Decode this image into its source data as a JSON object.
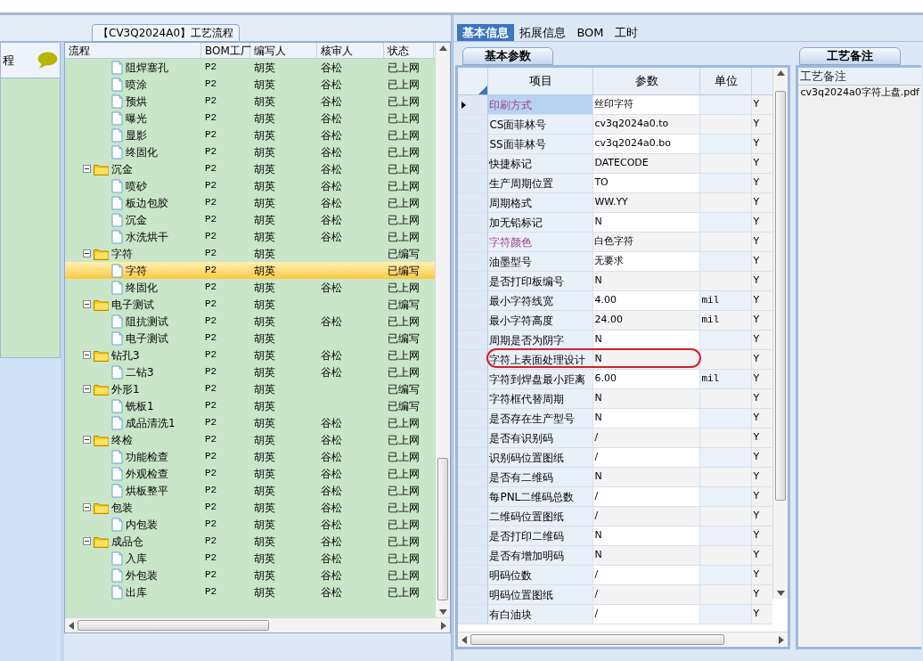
{
  "left_panel": {
    "label": "程"
  },
  "flow_group": {
    "title": "【CV3Q2024A0】工艺流程"
  },
  "tree_table": {
    "columns": [
      "流程",
      "BOM工厂",
      "编写人",
      "核审人",
      "状态"
    ],
    "nodes": [
      {
        "kind": "continued",
        "children": [
          {
            "kind": "step",
            "name": "阻焊塞孔",
            "bom": "P2",
            "writer": "胡英",
            "reviewer": "谷松",
            "status": "已上网",
            "selected": false
          },
          {
            "kind": "step",
            "name": "喷涂",
            "bom": "P2",
            "writer": "胡英",
            "reviewer": "谷松",
            "status": "已上网",
            "selected": false
          },
          {
            "kind": "step",
            "name": "预烘",
            "bom": "P2",
            "writer": "胡英",
            "reviewer": "谷松",
            "status": "已上网",
            "selected": false
          },
          {
            "kind": "step",
            "name": "曝光",
            "bom": "P2",
            "writer": "胡英",
            "reviewer": "谷松",
            "status": "已上网",
            "selected": false
          },
          {
            "kind": "step",
            "name": "显影",
            "bom": "P2",
            "writer": "胡英",
            "reviewer": "谷松",
            "status": "已上网",
            "selected": false
          },
          {
            "kind": "step",
            "name": "终固化",
            "bom": "P2",
            "writer": "胡英",
            "reviewer": "谷松",
            "status": "已上网",
            "selected": false
          }
        ]
      },
      {
        "kind": "folder",
        "name": "沉金",
        "bom": "P2",
        "writer": "胡英",
        "reviewer": "谷松",
        "status": "已上网",
        "selected": false,
        "expanded": true,
        "children": [
          {
            "kind": "step",
            "name": "喷砂",
            "bom": "P2",
            "writer": "胡英",
            "reviewer": "谷松",
            "status": "已上网",
            "selected": false
          },
          {
            "kind": "step",
            "name": "板边包胶",
            "bom": "P2",
            "writer": "胡英",
            "reviewer": "谷松",
            "status": "已上网",
            "selected": false
          },
          {
            "kind": "step",
            "name": "沉金",
            "bom": "P2",
            "writer": "胡英",
            "reviewer": "谷松",
            "status": "已上网",
            "selected": false
          },
          {
            "kind": "step",
            "name": "水洗烘干",
            "bom": "P2",
            "writer": "胡英",
            "reviewer": "谷松",
            "status": "已上网",
            "selected": false
          }
        ]
      },
      {
        "kind": "folder",
        "name": "字符",
        "bom": "P2",
        "writer": "胡英",
        "status": "已编写",
        "selected": false,
        "expanded": true,
        "children": [
          {
            "kind": "step",
            "name": "字符",
            "bom": "P2",
            "writer": "胡英",
            "status": "已编写",
            "selected": true
          },
          {
            "kind": "step",
            "name": "终固化",
            "bom": "P2",
            "writer": "胡英",
            "reviewer": "谷松",
            "status": "已上网",
            "selected": false
          }
        ]
      },
      {
        "kind": "folder",
        "name": "电子测试",
        "bom": "P2",
        "writer": "胡英",
        "status": "已编写",
        "selected": false,
        "expanded": true,
        "children": [
          {
            "kind": "step",
            "name": "阻抗测试",
            "bom": "P2",
            "writer": "胡英",
            "reviewer": "谷松",
            "status": "已上网",
            "selected": false
          },
          {
            "kind": "step",
            "name": "电子测试",
            "bom": "P2",
            "writer": "胡英",
            "status": "已编写",
            "selected": false
          }
        ]
      },
      {
        "kind": "folder",
        "name": "钻孔3",
        "bom": "P2",
        "writer": "胡英",
        "reviewer": "谷松",
        "status": "已上网",
        "selected": false,
        "expanded": true,
        "children": [
          {
            "kind": "step",
            "name": "二钻3",
            "bom": "P2",
            "writer": "胡英",
            "reviewer": "谷松",
            "status": "已上网",
            "selected": false
          }
        ]
      },
      {
        "kind": "folder",
        "name": "外形1",
        "bom": "P2",
        "writer": "胡英",
        "status": "已编写",
        "selected": false,
        "expanded": true,
        "children": [
          {
            "kind": "step",
            "name": "铣板1",
            "bom": "P2",
            "writer": "胡英",
            "status": "已编写",
            "selected": false
          },
          {
            "kind": "step",
            "name": "成品清洗1",
            "bom": "P2",
            "writer": "胡英",
            "reviewer": "谷松",
            "status": "已上网",
            "selected": false
          }
        ]
      },
      {
        "kind": "folder",
        "name": "终检",
        "bom": "P2",
        "writer": "胡英",
        "reviewer": "谷松",
        "status": "已上网",
        "selected": false,
        "expanded": true,
        "children": [
          {
            "kind": "step",
            "name": "功能检查",
            "bom": "P2",
            "writer": "胡英",
            "reviewer": "谷松",
            "status": "已上网",
            "selected": false
          },
          {
            "kind": "step",
            "name": "外观检查",
            "bom": "P2",
            "writer": "胡英",
            "reviewer": "谷松",
            "status": "已上网",
            "selected": false
          },
          {
            "kind": "step",
            "name": "烘板整平",
            "bom": "P2",
            "writer": "胡英",
            "reviewer": "谷松",
            "status": "已上网",
            "selected": false
          }
        ]
      },
      {
        "kind": "folder",
        "name": "包装",
        "bom": "P2",
        "writer": "胡英",
        "reviewer": "谷松",
        "status": "已上网",
        "selected": false,
        "expanded": true,
        "children": [
          {
            "kind": "step",
            "name": "内包装",
            "bom": "P2",
            "writer": "胡英",
            "reviewer": "谷松",
            "status": "已上网",
            "selected": false
          }
        ]
      },
      {
        "kind": "folder",
        "name": "成品仓",
        "bom": "P2",
        "writer": "胡英",
        "reviewer": "谷松",
        "status": "已上网",
        "selected": false,
        "expanded": true,
        "children": [
          {
            "kind": "step",
            "name": "入库",
            "bom": "P2",
            "writer": "胡英",
            "reviewer": "谷松",
            "status": "已上网",
            "selected": false
          },
          {
            "kind": "step",
            "name": "外包装",
            "bom": "P2",
            "writer": "胡英",
            "reviewer": "谷松",
            "status": "已上网",
            "selected": false
          },
          {
            "kind": "step",
            "name": "出库",
            "bom": "P2",
            "writer": "胡英",
            "reviewer": "谷松",
            "status": "已上网",
            "selected": false
          }
        ]
      }
    ]
  },
  "tabs": [
    {
      "label": "基本信息",
      "selected": true
    },
    {
      "label": "拓展信息",
      "selected": false
    },
    {
      "label": "BOM",
      "selected": false
    },
    {
      "label": "工时",
      "selected": false
    }
  ],
  "params_panel": {
    "tab": "基本参数",
    "columns": [
      "项目",
      "参数",
      "单位"
    ],
    "rows": [
      {
        "item": "印刷方式",
        "value": "丝印字符",
        "column_4": "Y",
        "selected": true,
        "highlighted": true,
        "circled": false
      },
      {
        "item": "CS面菲林号",
        "value": "cv3q2024a0.to",
        "column_4": "Y",
        "selected": false,
        "highlighted": false,
        "circled": false
      },
      {
        "item": "SS面菲林号",
        "value": "cv3q2024a0.bo",
        "column_4": "Y",
        "selected": false,
        "highlighted": false,
        "circled": false
      },
      {
        "item": "快捷标记",
        "value": "DATECODE",
        "column_4": "Y",
        "selected": false,
        "highlighted": false,
        "circled": false
      },
      {
        "item": "生产周期位置",
        "value": "TO",
        "column_4": "Y",
        "selected": false,
        "highlighted": false,
        "circled": false
      },
      {
        "item": "周期格式",
        "value": "WW.YY",
        "column_4": "Y",
        "selected": false,
        "highlighted": false,
        "circled": false
      },
      {
        "item": "加无铅标记",
        "value": "N",
        "column_4": "Y",
        "selected": false,
        "highlighted": false,
        "circled": false
      },
      {
        "item": "字符颜色",
        "value": "白色字符",
        "column_4": "Y",
        "selected": false,
        "highlighted": true,
        "circled": false
      },
      {
        "item": "油墨型号",
        "value": "无要求",
        "column_4": "Y",
        "selected": false,
        "highlighted": false,
        "circled": false
      },
      {
        "item": "是否打印板编号",
        "value": "N",
        "column_4": "Y",
        "selected": false,
        "highlighted": false,
        "circled": false
      },
      {
        "item": "最小字符线宽",
        "value": "4.00",
        "unit": "mil",
        "column_4": "Y",
        "selected": false,
        "highlighted": false,
        "circled": false
      },
      {
        "item": "最小字符高度",
        "value": "24.00",
        "unit": "mil",
        "column_4": "Y",
        "selected": false,
        "highlighted": false,
        "circled": false
      },
      {
        "item": "周期是否为阴字",
        "value": "N",
        "column_4": "Y",
        "selected": false,
        "highlighted": false,
        "circled": false
      },
      {
        "item": "字符上表面处理设计",
        "value": "N",
        "column_4": "Y",
        "selected": false,
        "highlighted": false,
        "circled": true
      },
      {
        "item": "字符到焊盘最小距离",
        "value": "6.00",
        "unit": "mil",
        "column_4": "Y",
        "selected": false,
        "highlighted": false,
        "circled": false
      },
      {
        "item": "字符框代替周期",
        "value": "N",
        "column_4": "Y",
        "selected": false,
        "highlighted": false,
        "circled": false
      },
      {
        "item": "是否存在生产型号",
        "value": "N",
        "column_4": "Y",
        "selected": false,
        "highlighted": false,
        "circled": false
      },
      {
        "item": "是否有识别码",
        "value": "/",
        "column_4": "Y",
        "selected": false,
        "highlighted": false,
        "circled": false
      },
      {
        "item": "识别码位置图纸",
        "value": "/",
        "column_4": "Y",
        "selected": false,
        "highlighted": false,
        "circled": false
      },
      {
        "item": "是否有二维码",
        "value": "N",
        "column_4": "Y",
        "selected": false,
        "highlighted": false,
        "circled": false
      },
      {
        "item": "每PNL二维码总数",
        "value": "/",
        "column_4": "Y",
        "selected": false,
        "highlighted": false,
        "circled": false
      },
      {
        "item": "二维码位置图纸",
        "value": "/",
        "column_4": "Y",
        "selected": false,
        "highlighted": false,
        "circled": false
      },
      {
        "item": "是否打印二维码",
        "value": "N",
        "column_4": "Y",
        "selected": false,
        "highlighted": false,
        "circled": false
      },
      {
        "item": "是否有增加明码",
        "value": "N",
        "column_4": "Y",
        "selected": false,
        "highlighted": false,
        "circled": false
      },
      {
        "item": "明码位数",
        "value": "/",
        "column_4": "Y",
        "selected": false,
        "highlighted": false,
        "circled": false
      },
      {
        "item": "明码位置图纸",
        "value": "/",
        "column_4": "Y",
        "selected": false,
        "highlighted": false,
        "circled": false
      },
      {
        "item": "有白油块",
        "value": "/",
        "column_4": "Y",
        "selected": false,
        "highlighted": false,
        "circled": false
      }
    ]
  },
  "notes_panel": {
    "tab": "工艺备注",
    "header": "工艺备注",
    "entries": [
      "cv3q2024a0字符上盘.pdf"
    ]
  }
}
